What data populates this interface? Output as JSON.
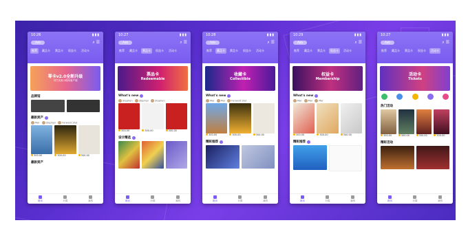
{
  "status_times": [
    "10:26",
    "10:27",
    "10:28",
    "10:29",
    "10:27"
  ],
  "search_text": "Aab",
  "tabs": [
    "推荐",
    "藏品卡",
    "票品卡",
    "权益卡",
    "活动卡"
  ],
  "phones": [
    {
      "hero_title": "零卡v2.0全新升级",
      "hero_sub": "可打实用小程序客户端",
      "hero_en": "",
      "active_tab": 0,
      "sec1": "品牌馆",
      "sec2": "最新资产",
      "sec3": "最新资产"
    },
    {
      "hero_title": "票品卡",
      "hero_sub": "Redeemable",
      "hero_en": "",
      "active_tab": 2,
      "sec1": "What's new",
      "sec2": "设计精选"
    },
    {
      "hero_title": "收藏卡",
      "hero_sub": "Collectible",
      "hero_en": "",
      "active_tab": 1,
      "sec1": "What's new",
      "sec2": "精彩推荐"
    },
    {
      "hero_title": "权益卡",
      "hero_sub": "Membership",
      "hero_en": "",
      "active_tab": 3,
      "sec1": "What's new",
      "sec2": "精彩推荐"
    },
    {
      "hero_title": "活动卡",
      "hero_sub": "Tickets",
      "hero_en": "",
      "active_tab": 4,
      "sec1": "热门活动",
      "sec2": "精彩活动"
    }
  ],
  "avatar_names": [
    "Mar",
    "Stephen",
    "Forward Stut"
  ],
  "price": "300.00",
  "nav": [
    "首页",
    "分类",
    "我的"
  ],
  "colors": {
    "banner": "#5a2fd0",
    "header": "#7a5cf0",
    "accent": "#8a6cf2"
  }
}
